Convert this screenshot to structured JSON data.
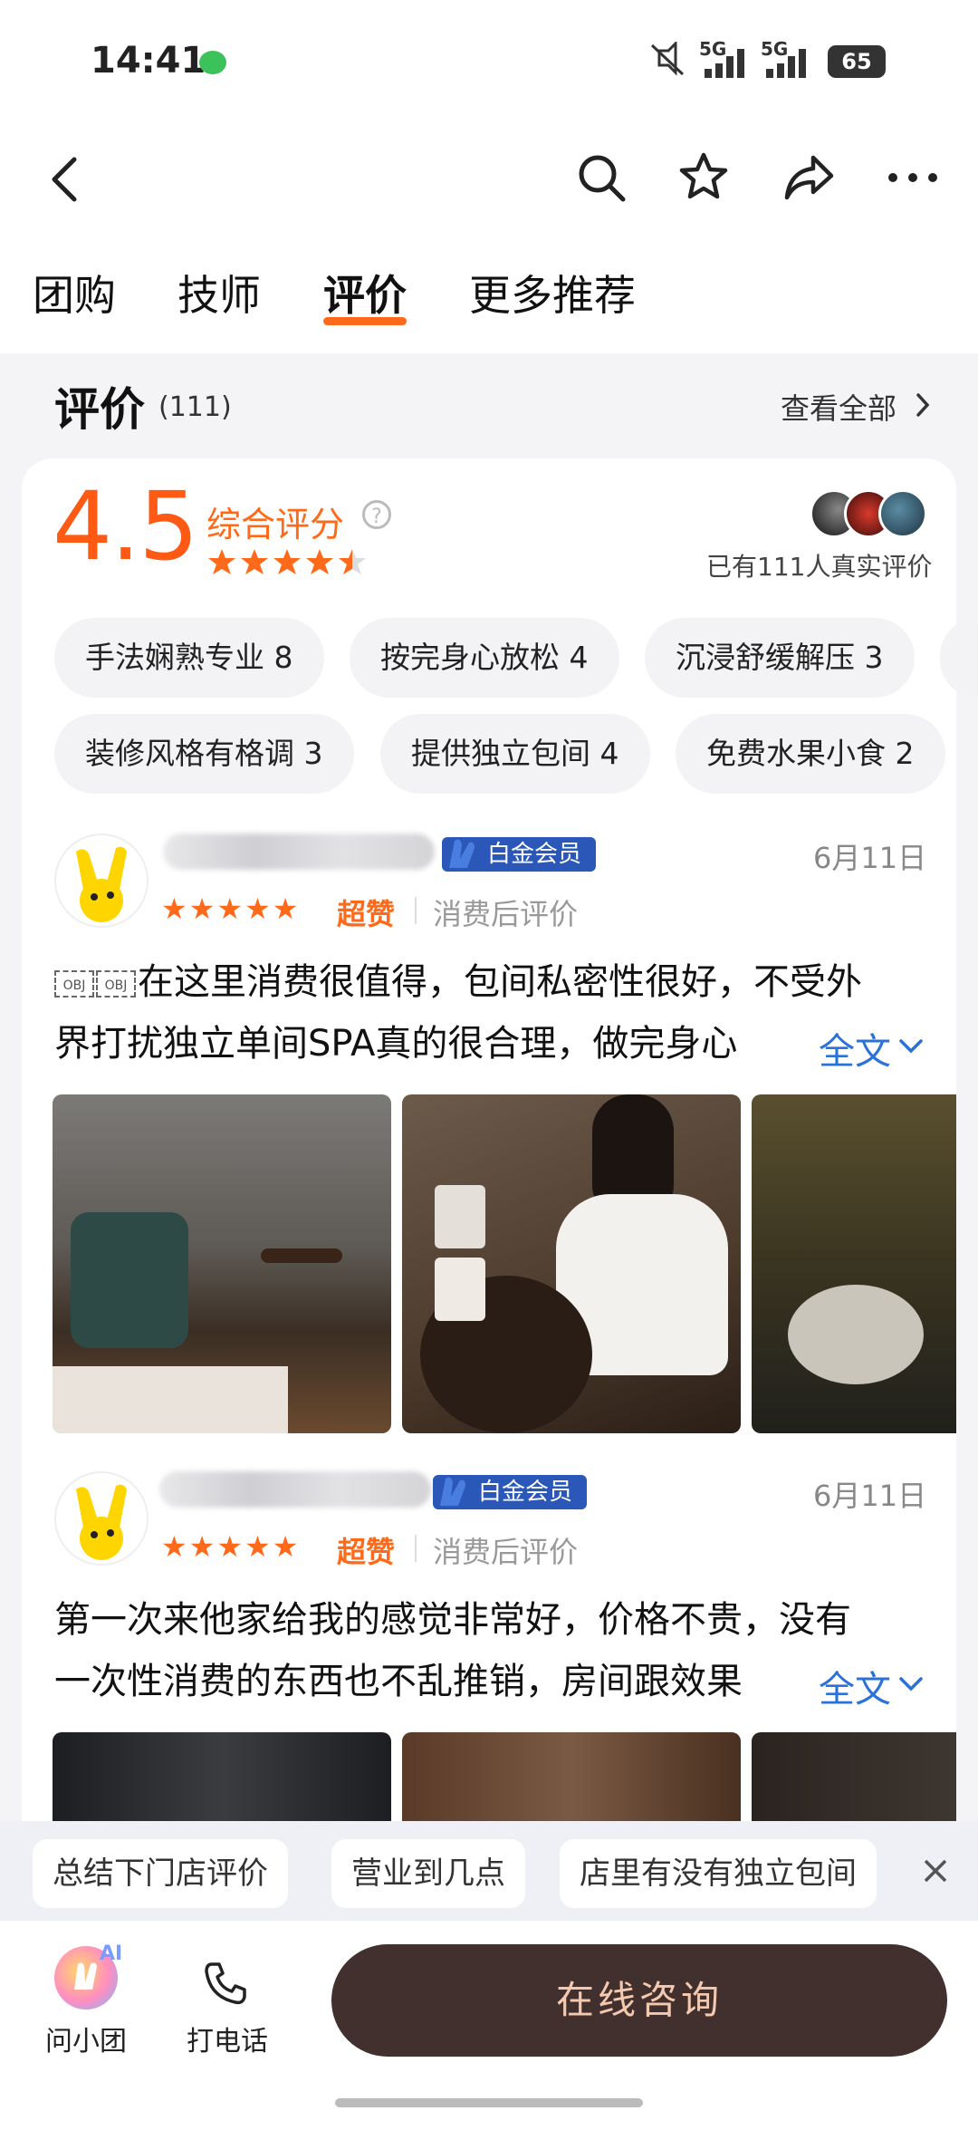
{
  "status_bar": {
    "time": "14:41",
    "network1": "5G",
    "network2": "5G",
    "battery": "65"
  },
  "nav": {
    "tabs": [
      {
        "label": "团购"
      },
      {
        "label": "技师"
      },
      {
        "label": "评价"
      },
      {
        "label": "更多推荐"
      }
    ],
    "active_tab_index": 2
  },
  "reviews_section": {
    "title": "评价",
    "count": "(111)",
    "see_all": "查看全部",
    "score": "4.5",
    "score_label": "综合评分",
    "score_stars": 4.5,
    "real_reviews": "已有111人真实评价",
    "tags": [
      {
        "label": "手法娴熟专业 8"
      },
      {
        "label": "按完身心放松 4"
      },
      {
        "label": "沉浸舒缓解压 3"
      },
      {
        "label": "装修风格有格调 3"
      },
      {
        "label": "提供独立包间 4"
      },
      {
        "label": "免费水果小食 2"
      }
    ],
    "reviews": [
      {
        "badge": "白金会员",
        "date": "6月11日",
        "rating_text": "超赞",
        "review_type": "消费后评价",
        "line1": "在这里消费很值得，包间私密性很好，不受外",
        "line2": "界打扰独立单间SPA真的很合理，做完身心",
        "full_text": "全文",
        "obj1": "OBJ",
        "obj2": "OBJ"
      },
      {
        "badge": "白金会员",
        "date": "6月11日",
        "rating_text": "超赞",
        "review_type": "消费后评价",
        "line1": "第一次来他家给我的感觉非常好，价格不贵，没有",
        "line2": "一次性消费的东西也不乱推销，房间跟效果",
        "full_text": "全文"
      }
    ]
  },
  "suggestions": [
    {
      "label": "总结下门店评价"
    },
    {
      "label": "营业到几点"
    },
    {
      "label": "店里有没有独立包间"
    }
  ],
  "bottom_bar": {
    "ask_label": "问小团",
    "ai_badge": "AI",
    "call_label": "打电话",
    "consult_label": "在线咨询"
  },
  "colors": {
    "accent_orange": "#ff6a1a",
    "link_blue": "#2a72d9",
    "consult_bg": "#42302e",
    "badge_blue": "#2b57b8"
  },
  "icons": [
    "back-icon",
    "search-icon",
    "star-outline-icon",
    "share-icon",
    "more-icon",
    "question-icon",
    "chevron-right-icon",
    "chevron-down-icon",
    "phone-icon",
    "close-icon"
  ]
}
